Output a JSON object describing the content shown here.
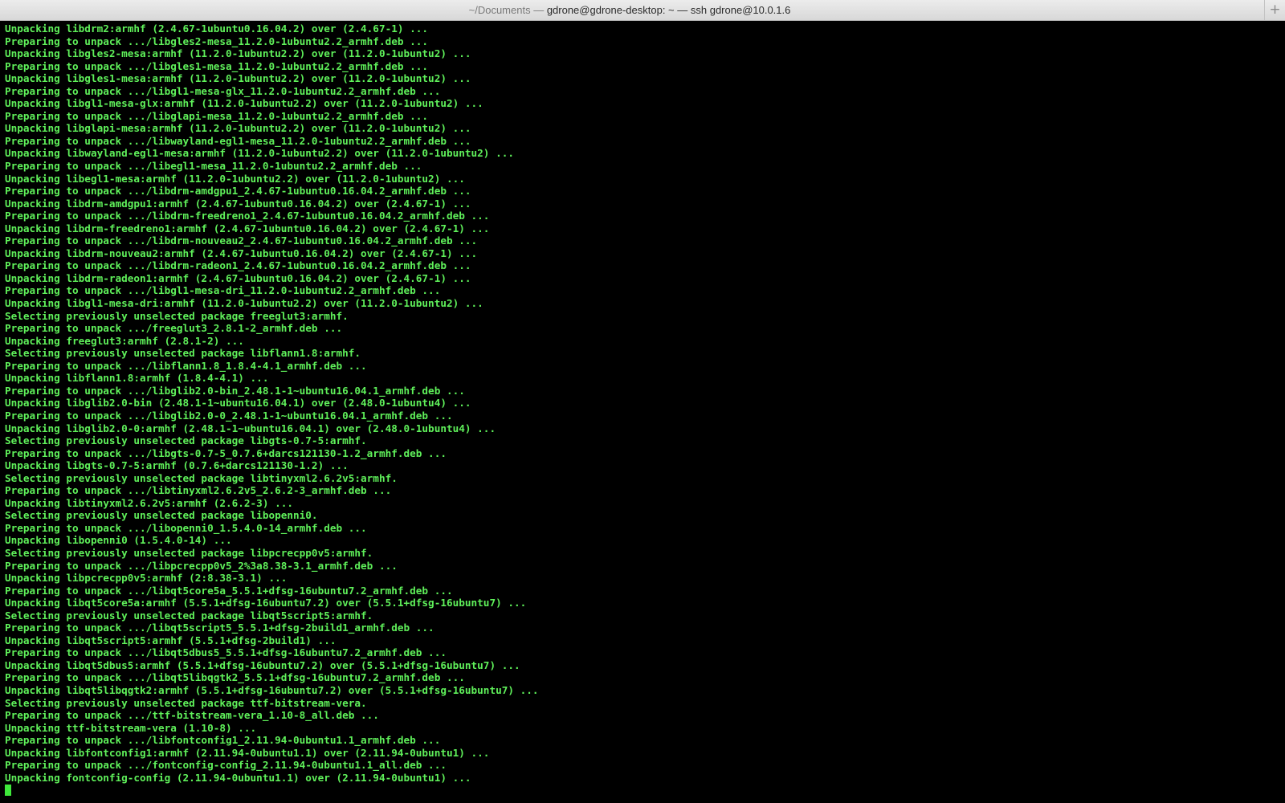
{
  "window": {
    "title_path": "~/Documents — ",
    "title_host": "gdrone@gdrone-desktop: ~ — ssh gdrone@10.0.1.6",
    "new_tab_icon": "plus-icon",
    "new_tab_glyph": "+"
  },
  "colors": {
    "terminal_background": "#000000",
    "terminal_text": "#5ff05a",
    "cursor": "#3ee83a"
  },
  "terminal": {
    "lines": [
      "Unpacking libdrm2:armhf (2.4.67-1ubuntu0.16.04.2) over (2.4.67-1) ...",
      "Preparing to unpack .../libgles2-mesa_11.2.0-1ubuntu2.2_armhf.deb ...",
      "Unpacking libgles2-mesa:armhf (11.2.0-1ubuntu2.2) over (11.2.0-1ubuntu2) ...",
      "Preparing to unpack .../libgles1-mesa_11.2.0-1ubuntu2.2_armhf.deb ...",
      "Unpacking libgles1-mesa:armhf (11.2.0-1ubuntu2.2) over (11.2.0-1ubuntu2) ...",
      "Preparing to unpack .../libgl1-mesa-glx_11.2.0-1ubuntu2.2_armhf.deb ...",
      "Unpacking libgl1-mesa-glx:armhf (11.2.0-1ubuntu2.2) over (11.2.0-1ubuntu2) ...",
      "Preparing to unpack .../libglapi-mesa_11.2.0-1ubuntu2.2_armhf.deb ...",
      "Unpacking libglapi-mesa:armhf (11.2.0-1ubuntu2.2) over (11.2.0-1ubuntu2) ...",
      "Preparing to unpack .../libwayland-egl1-mesa_11.2.0-1ubuntu2.2_armhf.deb ...",
      "Unpacking libwayland-egl1-mesa:armhf (11.2.0-1ubuntu2.2) over (11.2.0-1ubuntu2) ...",
      "Preparing to unpack .../libegl1-mesa_11.2.0-1ubuntu2.2_armhf.deb ...",
      "Unpacking libegl1-mesa:armhf (11.2.0-1ubuntu2.2) over (11.2.0-1ubuntu2) ...",
      "Preparing to unpack .../libdrm-amdgpu1_2.4.67-1ubuntu0.16.04.2_armhf.deb ...",
      "Unpacking libdrm-amdgpu1:armhf (2.4.67-1ubuntu0.16.04.2) over (2.4.67-1) ...",
      "Preparing to unpack .../libdrm-freedreno1_2.4.67-1ubuntu0.16.04.2_armhf.deb ...",
      "Unpacking libdrm-freedreno1:armhf (2.4.67-1ubuntu0.16.04.2) over (2.4.67-1) ...",
      "Preparing to unpack .../libdrm-nouveau2_2.4.67-1ubuntu0.16.04.2_armhf.deb ...",
      "Unpacking libdrm-nouveau2:armhf (2.4.67-1ubuntu0.16.04.2) over (2.4.67-1) ...",
      "Preparing to unpack .../libdrm-radeon1_2.4.67-1ubuntu0.16.04.2_armhf.deb ...",
      "Unpacking libdrm-radeon1:armhf (2.4.67-1ubuntu0.16.04.2) over (2.4.67-1) ...",
      "Preparing to unpack .../libgl1-mesa-dri_11.2.0-1ubuntu2.2_armhf.deb ...",
      "Unpacking libgl1-mesa-dri:armhf (11.2.0-1ubuntu2.2) over (11.2.0-1ubuntu2) ...",
      "Selecting previously unselected package freeglut3:armhf.",
      "Preparing to unpack .../freeglut3_2.8.1-2_armhf.deb ...",
      "Unpacking freeglut3:armhf (2.8.1-2) ...",
      "Selecting previously unselected package libflann1.8:armhf.",
      "Preparing to unpack .../libflann1.8_1.8.4-4.1_armhf.deb ...",
      "Unpacking libflann1.8:armhf (1.8.4-4.1) ...",
      "Preparing to unpack .../libglib2.0-bin_2.48.1-1~ubuntu16.04.1_armhf.deb ...",
      "Unpacking libglib2.0-bin (2.48.1-1~ubuntu16.04.1) over (2.48.0-1ubuntu4) ...",
      "Preparing to unpack .../libglib2.0-0_2.48.1-1~ubuntu16.04.1_armhf.deb ...",
      "Unpacking libglib2.0-0:armhf (2.48.1-1~ubuntu16.04.1) over (2.48.0-1ubuntu4) ...",
      "Selecting previously unselected package libgts-0.7-5:armhf.",
      "Preparing to unpack .../libgts-0.7-5_0.7.6+darcs121130-1.2_armhf.deb ...",
      "Unpacking libgts-0.7-5:armhf (0.7.6+darcs121130-1.2) ...",
      "Selecting previously unselected package libtinyxml2.6.2v5:armhf.",
      "Preparing to unpack .../libtinyxml2.6.2v5_2.6.2-3_armhf.deb ...",
      "Unpacking libtinyxml2.6.2v5:armhf (2.6.2-3) ...",
      "Selecting previously unselected package libopenni0.",
      "Preparing to unpack .../libopenni0_1.5.4.0-14_armhf.deb ...",
      "Unpacking libopenni0 (1.5.4.0-14) ...",
      "Selecting previously unselected package libpcrecpp0v5:armhf.",
      "Preparing to unpack .../libpcrecpp0v5_2%3a8.38-3.1_armhf.deb ...",
      "Unpacking libpcrecpp0v5:armhf (2:8.38-3.1) ...",
      "Preparing to unpack .../libqt5core5a_5.5.1+dfsg-16ubuntu7.2_armhf.deb ...",
      "Unpacking libqt5core5a:armhf (5.5.1+dfsg-16ubuntu7.2) over (5.5.1+dfsg-16ubuntu7) ...",
      "Selecting previously unselected package libqt5script5:armhf.",
      "Preparing to unpack .../libqt5script5_5.5.1+dfsg-2build1_armhf.deb ...",
      "Unpacking libqt5script5:armhf (5.5.1+dfsg-2build1) ...",
      "Preparing to unpack .../libqt5dbus5_5.5.1+dfsg-16ubuntu7.2_armhf.deb ...",
      "Unpacking libqt5dbus5:armhf (5.5.1+dfsg-16ubuntu7.2) over (5.5.1+dfsg-16ubuntu7) ...",
      "Preparing to unpack .../libqt5libqgtk2_5.5.1+dfsg-16ubuntu7.2_armhf.deb ...",
      "Unpacking libqt5libqgtk2:armhf (5.5.1+dfsg-16ubuntu7.2) over (5.5.1+dfsg-16ubuntu7) ...",
      "Selecting previously unselected package ttf-bitstream-vera.",
      "Preparing to unpack .../ttf-bitstream-vera_1.10-8_all.deb ...",
      "Unpacking ttf-bitstream-vera (1.10-8) ...",
      "Preparing to unpack .../libfontconfig1_2.11.94-0ubuntu1.1_armhf.deb ...",
      "Unpacking libfontconfig1:armhf (2.11.94-0ubuntu1.1) over (2.11.94-0ubuntu1) ...",
      "Preparing to unpack .../fontconfig-config_2.11.94-0ubuntu1.1_all.deb ...",
      "Unpacking fontconfig-config (2.11.94-0ubuntu1.1) over (2.11.94-0ubuntu1) ..."
    ]
  }
}
